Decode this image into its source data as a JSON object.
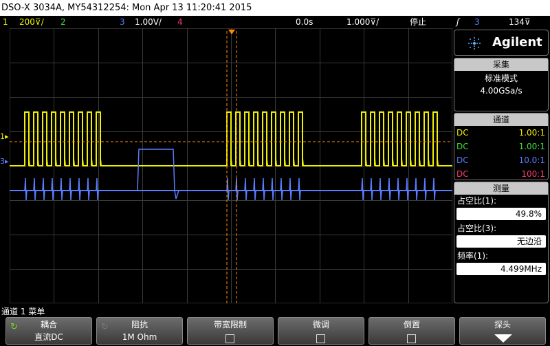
{
  "titlebar": {
    "text": "DSO-X 3034A, MY54312254: Mon Apr 13 11:20:41 2015"
  },
  "status": {
    "ch1_num": "1",
    "ch1_scale": "200⊽/",
    "ch2_num": "2",
    "ch3_num": "3",
    "ch3_scale": "1.00V/",
    "ch4_num": "4",
    "time_pos": "0.0s",
    "time_scale": "1.000⊽/",
    "run_state": "停止",
    "trig_icon": "ʃ",
    "trig_ch": "3",
    "trig_level": "134⊽"
  },
  "colors": {
    "ch1": "#f0f000",
    "ch2": "#3ee03e",
    "ch3": "#5a7cff",
    "ch4": "#ff3c6e",
    "trigger": "#ff8c00",
    "grid": "#3a3a3a"
  },
  "panel": {
    "brand": "Agilent",
    "acq": {
      "header": "采集",
      "mode": "标准模式",
      "rate": "4.00GSa/s"
    },
    "channels": {
      "header": "通道",
      "rows": [
        {
          "coupling": "DC",
          "probe": "1.00:1"
        },
        {
          "coupling": "DC",
          "probe": "1.00:1"
        },
        {
          "coupling": "DC",
          "probe": "10.0:1"
        },
        {
          "coupling": "DC",
          "probe": "100:1"
        }
      ]
    },
    "measure": {
      "header": "测量",
      "items": [
        {
          "label": "占空比(1):",
          "value": "49.8%"
        },
        {
          "label": "占空比(3):",
          "value": "无边沿"
        },
        {
          "label": "频率(1):",
          "value": "4.499MHz"
        }
      ]
    }
  },
  "menu_label": "通道 1 菜单",
  "softkeys": [
    {
      "title": "耦合",
      "value": "直流DC"
    },
    {
      "title": "阻抗",
      "value": "1M Ohm"
    },
    {
      "title": "带宽限制",
      "value": ""
    },
    {
      "title": "微调",
      "value": ""
    },
    {
      "title": "倒置",
      "value": ""
    },
    {
      "title": "探头",
      "value": ""
    }
  ],
  "markers": {
    "ch1": "1",
    "ch3": "3"
  }
}
